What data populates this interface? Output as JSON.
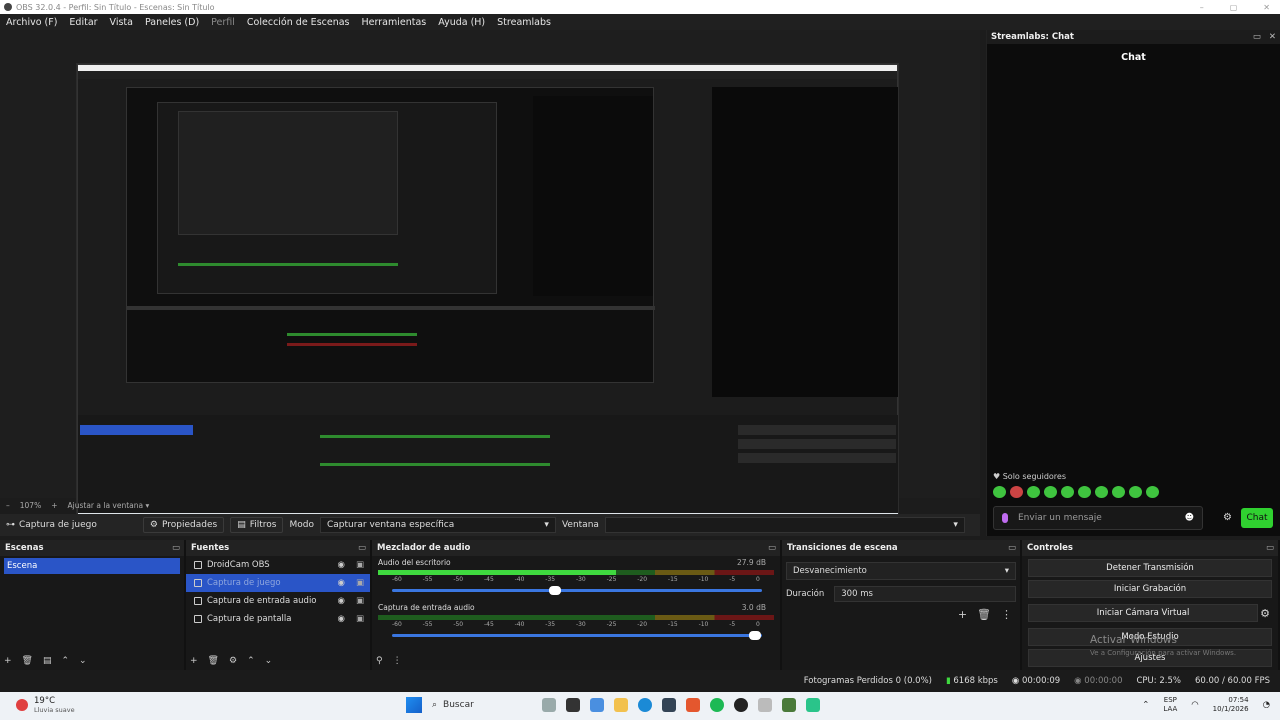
{
  "window": {
    "title": "OBS 32.0.4 - Perfil: Sin Título - Escenas: Sin Título",
    "controls": [
      "–",
      "▢",
      "✕"
    ]
  },
  "menu": [
    {
      "label": "Archivo (F)",
      "dim": false
    },
    {
      "label": "Editar",
      "dim": false
    },
    {
      "label": "Vista",
      "dim": false
    },
    {
      "label": "Paneles (D)",
      "dim": false
    },
    {
      "label": "Perfil",
      "dim": true
    },
    {
      "label": "Colección de Escenas",
      "dim": false
    },
    {
      "label": "Herramientas",
      "dim": false
    },
    {
      "label": "Ayuda (H)",
      "dim": false
    },
    {
      "label": "Streamlabs",
      "dim": false
    }
  ],
  "zoom": {
    "value": "107%",
    "fit": "Ajustar a la ventana"
  },
  "chat": {
    "dock_title": "Streamlabs: Chat",
    "title": "Chat",
    "followers": "Solo seguidores",
    "input_placeholder": "Enviar un mensaje",
    "send_label": "Chat"
  },
  "source_toolbar": {
    "source": "Captura de juego",
    "properties": "Propiedades",
    "filters": "Filtros",
    "mode_label": "Modo",
    "mode_value": "Capturar ventana específica",
    "window_label": "Ventana"
  },
  "scenes": {
    "title": "Escenas",
    "items": [
      "Escena"
    ]
  },
  "sources": {
    "title": "Fuentes",
    "items": [
      "DroidCam OBS",
      "Captura de juego",
      "Captura de entrada audio",
      "Captura de pantalla"
    ]
  },
  "mixer": {
    "title": "Mezclador de audio",
    "channels": [
      {
        "name": "Audio del escritorio",
        "db": "27.9 dB",
        "level": 0.6,
        "volume": 0.44
      },
      {
        "name": "Captura de entrada audio",
        "db": "3.0 dB",
        "level": 0.0,
        "volume": 0.98
      }
    ],
    "scale": [
      "-60",
      "-55",
      "-50",
      "-45",
      "-40",
      "-35",
      "-30",
      "-25",
      "-20",
      "-15",
      "-10",
      "-5",
      "0"
    ]
  },
  "transitions": {
    "title": "Transiciones de escena",
    "selected": "Desvanecimiento",
    "duration_label": "Duración",
    "duration": "300 ms"
  },
  "controls": {
    "title": "Controles",
    "buttons": [
      "Detener Transmisión",
      "Iniciar Grabación",
      "Iniciar Cámara Virtual",
      "Modo Estudio",
      "Ajustes"
    ]
  },
  "watermark": {
    "line1": "Activar Windows",
    "line2": "Ve a Configuración para activar Windows."
  },
  "status": {
    "dropped": "Fotogramas Perdidos 0 (0.0%)",
    "bitrate": "6168 kbps",
    "stream_time": "00:00:09",
    "rec_time": "00:00:00",
    "cpu": "CPU: 2.5%",
    "fps": "60.00 / 60.00 FPS"
  },
  "taskbar": {
    "temp": "19°C",
    "weather": "Lluvia suave",
    "search": "Buscar",
    "lang1": "ESP",
    "lang2": "LAA",
    "time": "07:54",
    "date": "10/1/2026"
  }
}
